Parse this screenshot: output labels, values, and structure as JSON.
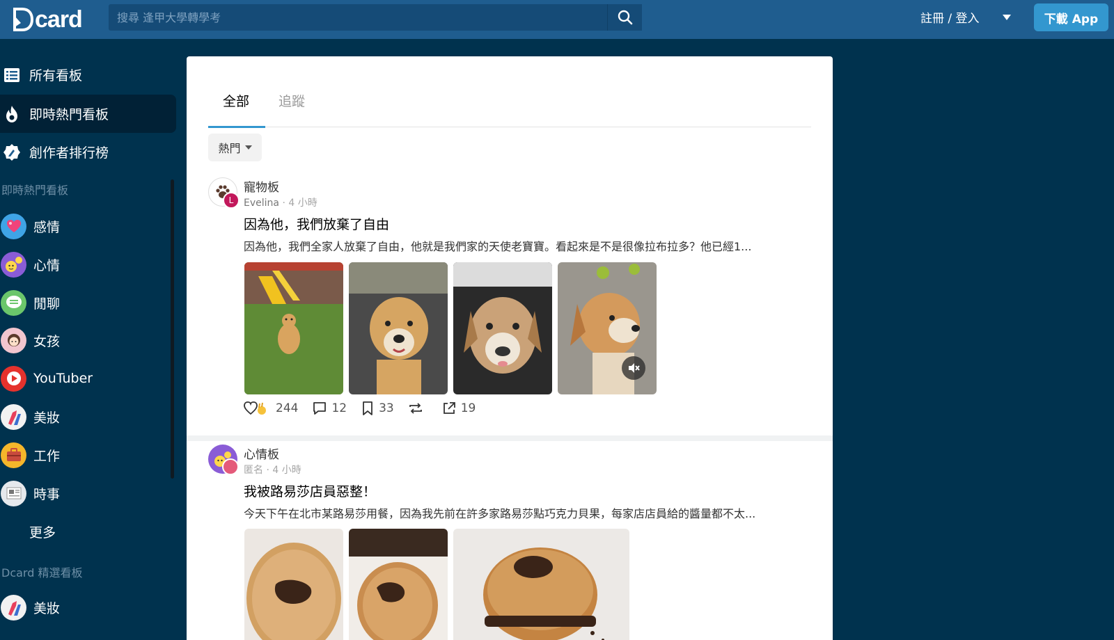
{
  "header": {
    "logo": "Dcard",
    "search_placeholder": "搜尋 逢甲大學轉學考",
    "login_label": "註冊 / 登入",
    "download_label": "下載 App"
  },
  "sidebar": {
    "nav": [
      {
        "label": "所有看板",
        "icon": "list-icon"
      },
      {
        "label": "即時熱門看板",
        "icon": "fire-icon"
      },
      {
        "label": "創作者排行榜",
        "icon": "pen-badge-icon"
      }
    ],
    "section_hot": "即時熱門看板",
    "boards": [
      {
        "label": "感情",
        "icon": "hearts-avatar",
        "color": "#3fa4e6"
      },
      {
        "label": "心情",
        "icon": "mood-avatar",
        "color": "#8a5cd6"
      },
      {
        "label": "閒聊",
        "icon": "chat-avatar",
        "color": "#6bc66b"
      },
      {
        "label": "女孩",
        "icon": "girl-avatar",
        "color": "#f2c6cf"
      },
      {
        "label": "YouTuber",
        "icon": "youtube-avatar",
        "color": "#e5322d"
      },
      {
        "label": "美妝",
        "icon": "lipstick-avatar",
        "color": "#f2f2f2"
      },
      {
        "label": "工作",
        "icon": "briefcase-avatar",
        "color": "#f5b62b"
      },
      {
        "label": "時事",
        "icon": "newspaper-avatar",
        "color": "#e6e9ed"
      }
    ],
    "more_label": "更多",
    "section_featured": "Dcard 精選看板",
    "featured": [
      {
        "label": "美妝",
        "icon": "lipstick-avatar",
        "color": "#f2f2f2"
      }
    ]
  },
  "main": {
    "tabs": [
      "全部",
      "追蹤"
    ],
    "sort_label": "熱門",
    "posts": [
      {
        "board": "寵物板",
        "author": "Evelina",
        "author_initial": "L",
        "time": "4 小時",
        "title": "因為他，我們放棄了自由",
        "excerpt": "因為他，我們全家人放棄了自由，他就是我們家的天使老寶寶。看起來是不是很像拉布拉多？他已經1...",
        "likes": "244",
        "comments": "12",
        "bookmarks": "33",
        "shares": "19"
      },
      {
        "board": "心情板",
        "author": "匿名",
        "time": "4 小時",
        "title": "我被路易莎店員惡整！",
        "excerpt": "今天下午在北市某路易莎用餐，因為我先前在許多家路易莎點巧克力貝果，每家店店員給的醬量都不太..."
      }
    ]
  }
}
